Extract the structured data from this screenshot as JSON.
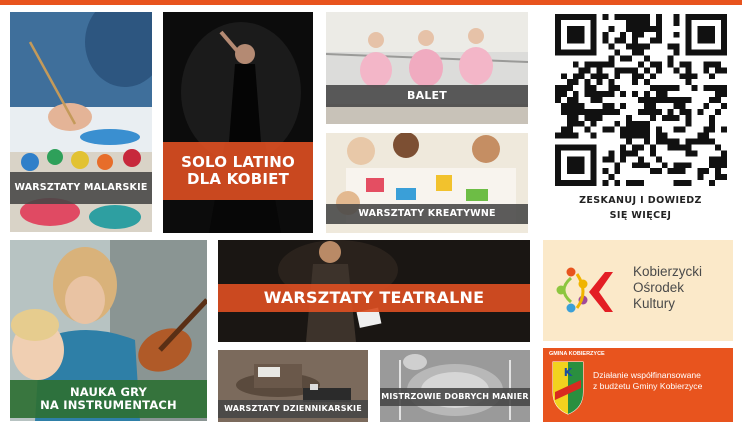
{
  "colors": {
    "accent": "#e8541e",
    "label_dark": "#464646",
    "label_orange": "#da4e22",
    "label_green": "#2e7034",
    "logo_panel": "#fbe9c9",
    "funding_panel": "#e8541e"
  },
  "tiles": {
    "painting": {
      "label": "WARSZTATY MALARSKIE"
    },
    "latino": {
      "line1": "SOLO LATINO",
      "line2": "DLA KOBIET"
    },
    "ballet": {
      "label": "BALET"
    },
    "creative": {
      "label": "WARSZTATY KREATYWNE"
    },
    "instruments": {
      "line1": "NAUKA GRY",
      "line2": "NA INSTRUMENTACH"
    },
    "theatre": {
      "label": "WARSZTATY TEATRALNE"
    },
    "journalism": {
      "label": "WARSZTATY DZIENNIKARSKIE"
    },
    "manners": {
      "label": "MISTRZOWIE DOBRYCH MANIER"
    }
  },
  "qr": {
    "line1": "ZESKANUJ I DOWIEDZ",
    "line2": "SIĘ WIĘCEJ"
  },
  "logo": {
    "line1": "Kobierzycki",
    "line2": "Ośrodek",
    "line3": "Kultury"
  },
  "funding": {
    "emblem_text": "GMINA KOBIERZYCE",
    "line1": "Działanie współfinansowane",
    "line2": "z budżetu Gminy Kobierzyce"
  }
}
